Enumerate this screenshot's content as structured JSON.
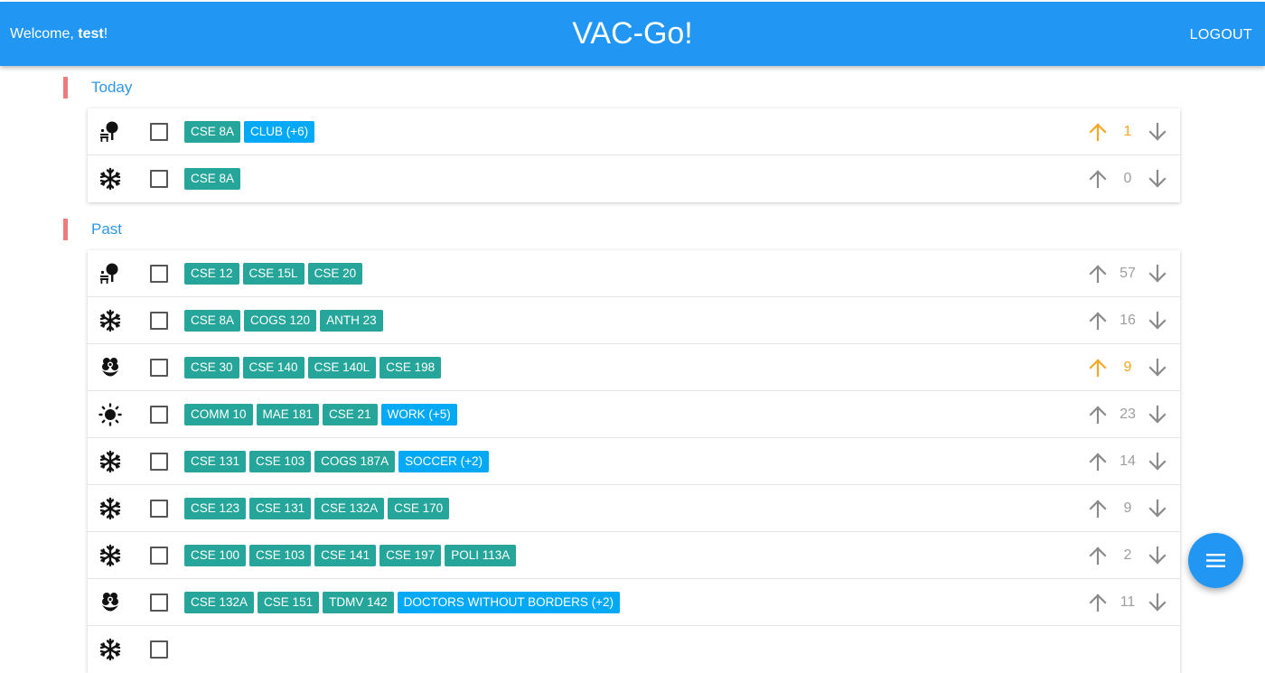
{
  "header": {
    "welcome_prefix": "Welcome, ",
    "username": "test",
    "welcome_suffix": "!",
    "title": "VAC-Go!",
    "logout_label": "LOGOUT"
  },
  "colors": {
    "primary": "#2196f3",
    "section_bar": "#ef7c7c",
    "class_tag": "#26a69a",
    "other_tag": "#03a9f4",
    "upvote_active": "#f5a623"
  },
  "sections": [
    {
      "label": "Today",
      "rows": [
        {
          "icon": "fall-tree-bench-icon",
          "tags": [
            {
              "text": "CSE 8A",
              "kind": "class"
            },
            {
              "text": "CLUB (+6)",
              "kind": "other"
            }
          ],
          "votes": "1",
          "upvoted": true
        },
        {
          "icon": "winter-snowflake-icon",
          "tags": [
            {
              "text": "CSE 8A",
              "kind": "class"
            }
          ],
          "votes": "0",
          "upvoted": false
        }
      ]
    },
    {
      "label": "Past",
      "rows": [
        {
          "icon": "fall-tree-bench-icon",
          "tags": [
            {
              "text": "CSE 12",
              "kind": "class"
            },
            {
              "text": "CSE 15L",
              "kind": "class"
            },
            {
              "text": "CSE 20",
              "kind": "class"
            }
          ],
          "votes": "57",
          "upvoted": false
        },
        {
          "icon": "winter-snowflake-icon",
          "tags": [
            {
              "text": "CSE 8A",
              "kind": "class"
            },
            {
              "text": "COGS 120",
              "kind": "class"
            },
            {
              "text": "ANTH 23",
              "kind": "class"
            }
          ],
          "votes": "16",
          "upvoted": false
        },
        {
          "icon": "spring-flower-icon",
          "tags": [
            {
              "text": "CSE 30",
              "kind": "class"
            },
            {
              "text": "CSE 140",
              "kind": "class"
            },
            {
              "text": "CSE 140L",
              "kind": "class"
            },
            {
              "text": "CSE 198",
              "kind": "class"
            }
          ],
          "votes": "9",
          "upvoted": true
        },
        {
          "icon": "summer-sun-icon",
          "tags": [
            {
              "text": "COMM 10",
              "kind": "class"
            },
            {
              "text": "MAE 181",
              "kind": "class"
            },
            {
              "text": "CSE 21",
              "kind": "class"
            },
            {
              "text": "WORK (+5)",
              "kind": "other"
            }
          ],
          "votes": "23",
          "upvoted": false
        },
        {
          "icon": "winter-snowflake-icon",
          "tags": [
            {
              "text": "CSE 131",
              "kind": "class"
            },
            {
              "text": "CSE 103",
              "kind": "class"
            },
            {
              "text": "COGS 187A",
              "kind": "class"
            },
            {
              "text": "SOCCER (+2)",
              "kind": "other"
            }
          ],
          "votes": "14",
          "upvoted": false
        },
        {
          "icon": "winter-snowflake-icon",
          "tags": [
            {
              "text": "CSE 123",
              "kind": "class"
            },
            {
              "text": "CSE 131",
              "kind": "class"
            },
            {
              "text": "CSE 132A",
              "kind": "class"
            },
            {
              "text": "CSE 170",
              "kind": "class"
            }
          ],
          "votes": "9",
          "upvoted": false
        },
        {
          "icon": "winter-snowflake-icon",
          "tags": [
            {
              "text": "CSE 100",
              "kind": "class"
            },
            {
              "text": "CSE 103",
              "kind": "class"
            },
            {
              "text": "CSE 141",
              "kind": "class"
            },
            {
              "text": "CSE 197",
              "kind": "class"
            },
            {
              "text": "POLI 113A",
              "kind": "class"
            }
          ],
          "votes": "2",
          "upvoted": false
        },
        {
          "icon": "spring-flower-icon",
          "tags": [
            {
              "text": "CSE 132A",
              "kind": "class"
            },
            {
              "text": "CSE 151",
              "kind": "class"
            },
            {
              "text": "TDMV 142",
              "kind": "class"
            },
            {
              "text": "DOCTORS WITHOUT BORDERS (+2)",
              "kind": "other"
            }
          ],
          "votes": "11",
          "upvoted": false
        },
        {
          "icon": "winter-snowflake-icon",
          "tags": [],
          "votes": "",
          "upvoted": false
        }
      ]
    }
  ],
  "fab": {
    "icon": "menu-icon"
  }
}
